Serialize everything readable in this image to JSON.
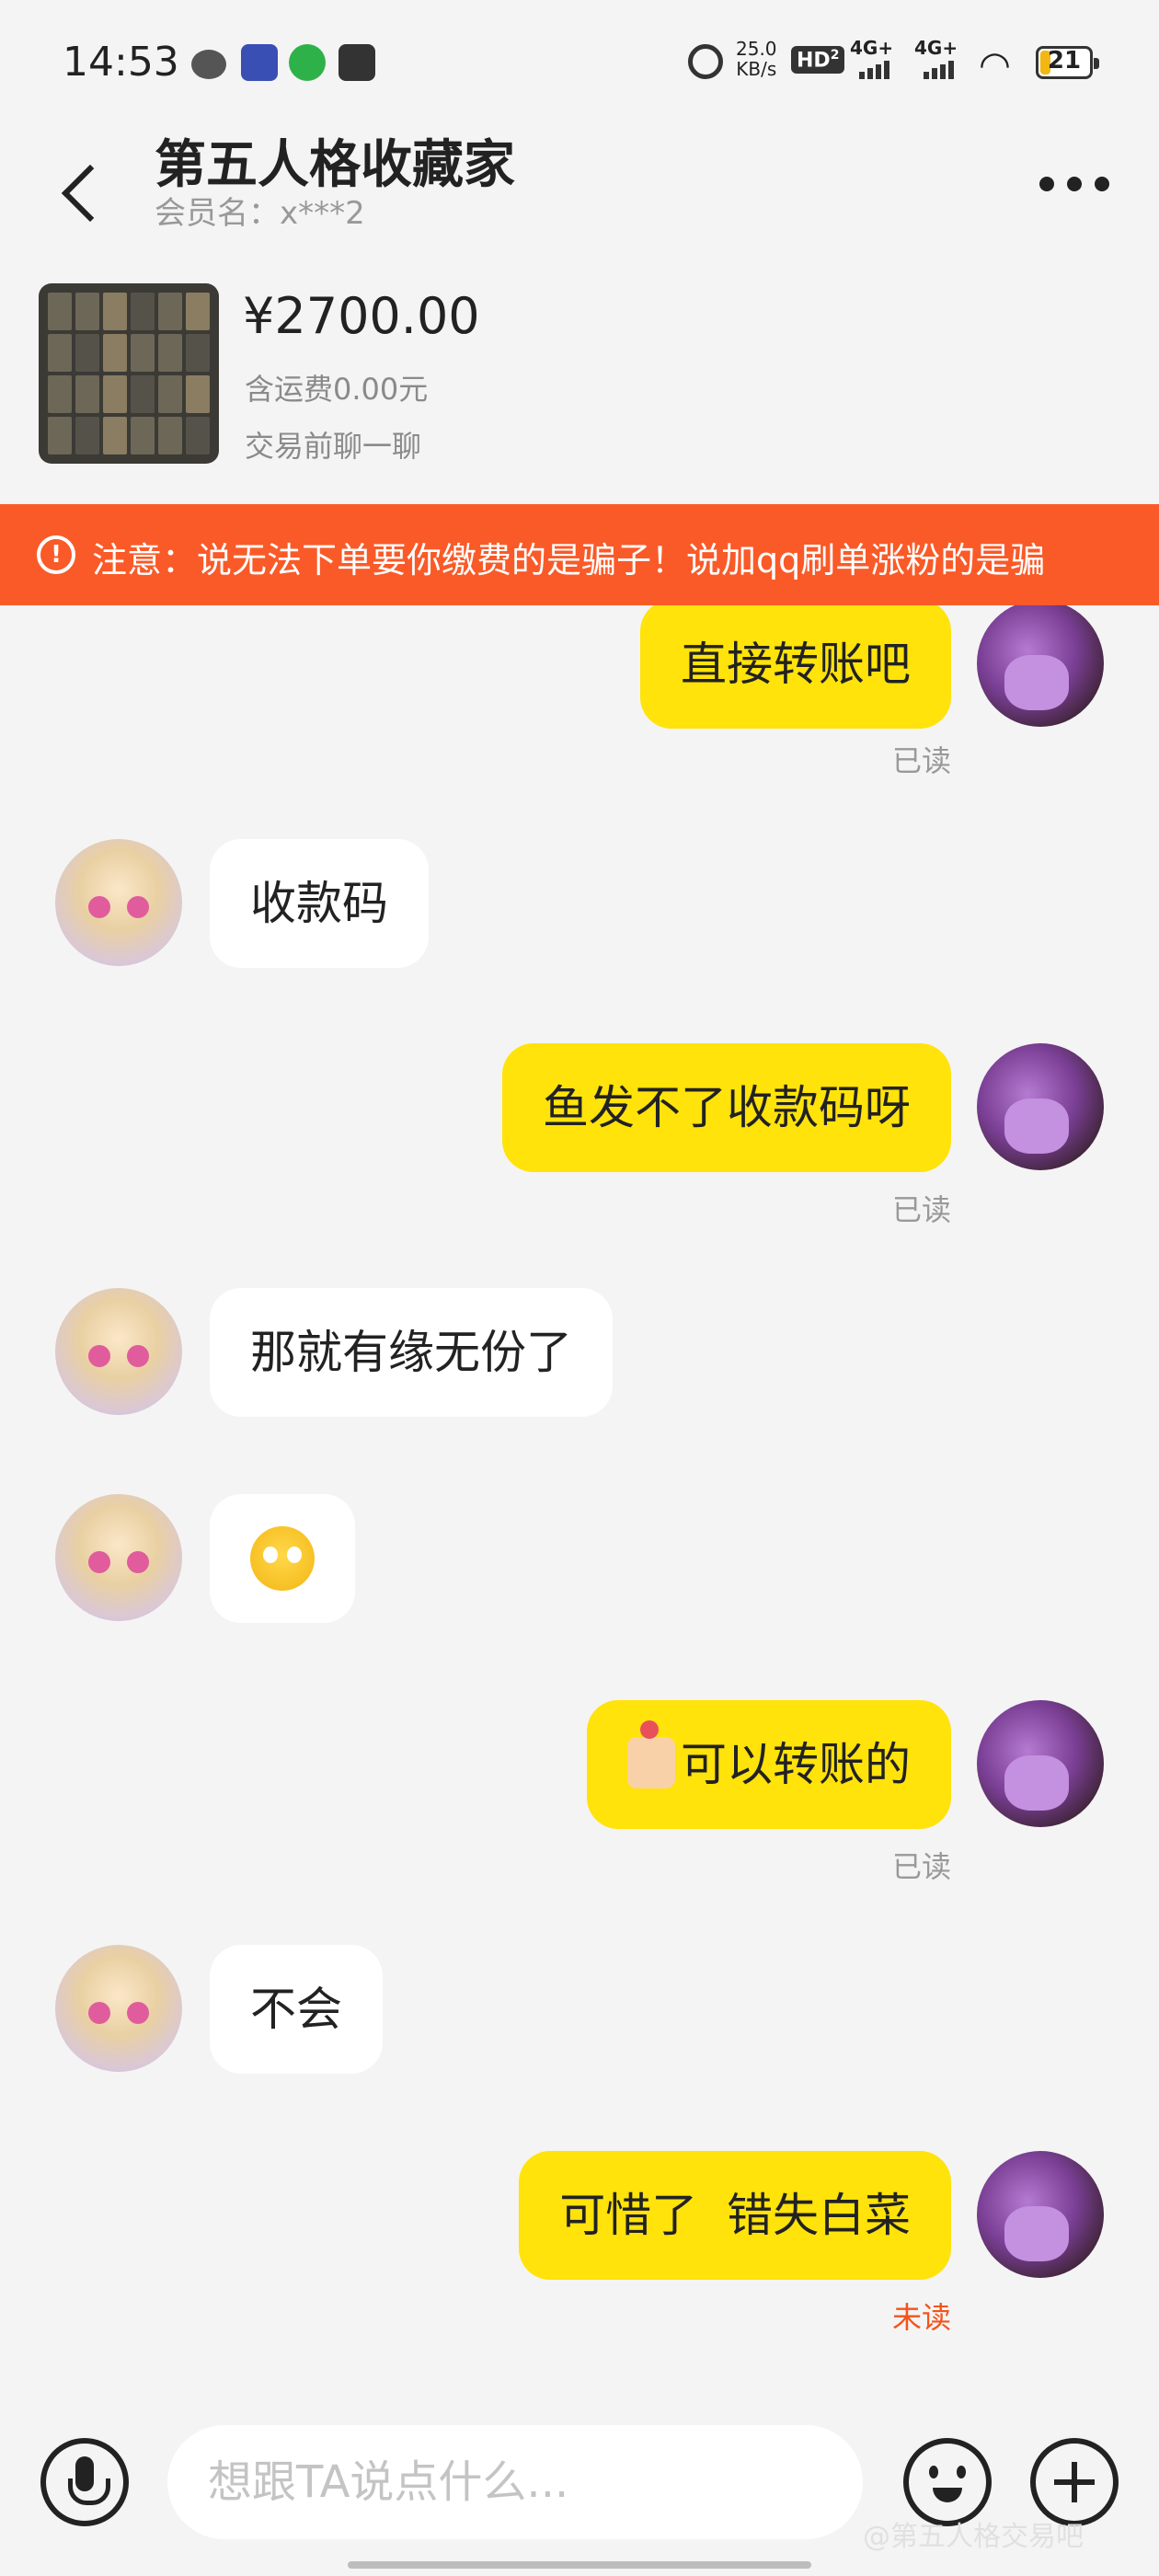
{
  "status_bar": {
    "time": "14:53",
    "speed": "25.0",
    "speed_unit": "KB/s",
    "hd_label": "HD",
    "hd_sub": "2",
    "network1": "4G+",
    "network2": "4G+",
    "battery": "21"
  },
  "header": {
    "title": "第五人格收藏家",
    "member_name": "会员名：x***2"
  },
  "product": {
    "price": "¥2700.00",
    "shipping": "含运费0.00元",
    "note": "交易前聊一聊"
  },
  "warning": {
    "text": "注意：说无法下单要你缴费的是骗子！说加qq刷单涨粉的是骗"
  },
  "messages": [
    {
      "from": "me",
      "text": "直接转账吧",
      "status": "已读"
    },
    {
      "from": "other",
      "text": "收款码"
    },
    {
      "from": "me",
      "text": "鱼发不了收款码呀",
      "status": "已读"
    },
    {
      "from": "other",
      "text": "那就有缘无份了"
    },
    {
      "from": "other",
      "emoji": "crying-face-emoji"
    },
    {
      "from": "me",
      "text": "可以转账的",
      "emoji": "pointing-hand-flower-emoji",
      "status": "已读"
    },
    {
      "from": "other",
      "text": "不会"
    },
    {
      "from": "me",
      "text": "可惜了  错失白菜",
      "status": "未读"
    }
  ],
  "input": {
    "placeholder": "想跟TA说点什么..."
  },
  "watermark": "@第五人格交易吧",
  "colors": {
    "my_bubble": "#ffe30a",
    "warning_banner": "#fa5a28",
    "unread": "#f3541c"
  }
}
